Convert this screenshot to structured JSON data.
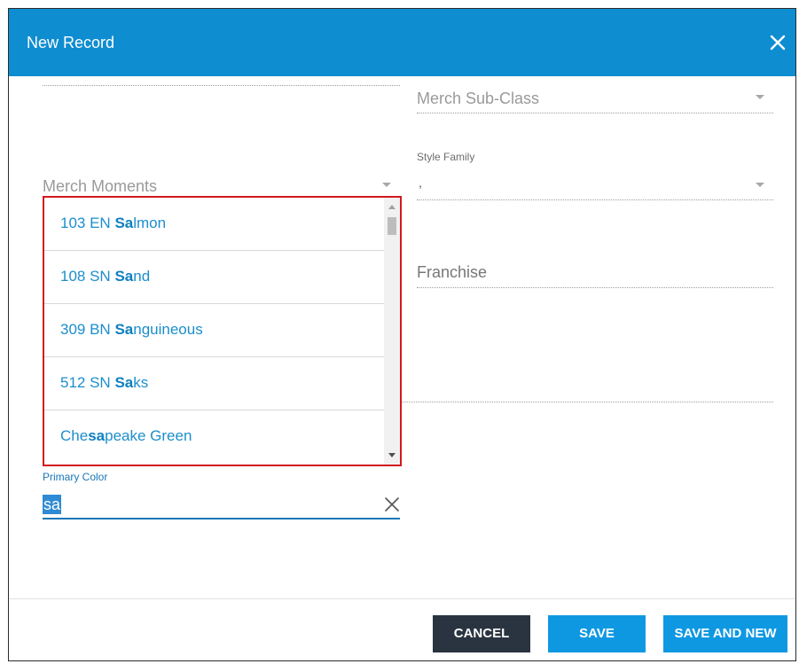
{
  "dialog": {
    "title": "New Record",
    "close_icon": "close-icon",
    "header_color": "#0f8dd1"
  },
  "fields": {
    "merch_sub_class": {
      "label": "Merch Sub-Class"
    },
    "style_family": {
      "label": "Style Family",
      "value": ","
    },
    "merch_moments": {
      "label": "Merch Moments"
    },
    "franchise": {
      "label": "Franchise"
    },
    "primary_color": {
      "label": "Primary Color",
      "value": "sa",
      "clear_icon": "clear-icon"
    }
  },
  "dropdown": {
    "highlight_color": "#d3191f",
    "items": [
      {
        "pre": "103 EN ",
        "match": "Sa",
        "post": "lmon"
      },
      {
        "pre": "108 SN ",
        "match": "Sa",
        "post": "nd"
      },
      {
        "pre": "309 BN ",
        "match": "Sa",
        "post": "nguineous"
      },
      {
        "pre": "512 SN ",
        "match": "Sa",
        "post": "ks"
      },
      {
        "pre": "Che",
        "match": "sa",
        "post": "peake Green"
      }
    ]
  },
  "footer": {
    "cancel_label": "CANCEL",
    "save_label": "SAVE",
    "save_new_label": "SAVE AND NEW"
  }
}
